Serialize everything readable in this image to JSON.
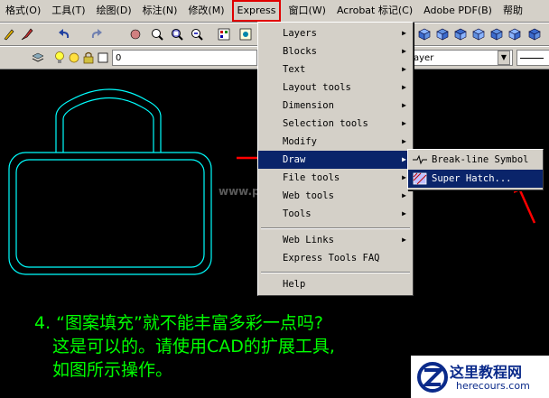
{
  "menubar": {
    "items": [
      "格式(O)",
      "工具(T)",
      "绘图(D)",
      "标注(N)",
      "修改(M)",
      "Express",
      "窗口(W)",
      "Acrobat 标记(C)",
      "Adobe PDF(B)",
      "帮助"
    ]
  },
  "toolbar2": {
    "layer_value": "0",
    "layer_right": "ayer"
  },
  "express_menu": {
    "items": [
      {
        "label": "Layers",
        "submenu": true
      },
      {
        "label": "Blocks",
        "submenu": true
      },
      {
        "label": "Text",
        "submenu": true
      },
      {
        "label": "Layout tools",
        "submenu": true
      },
      {
        "label": "Dimension",
        "submenu": true
      },
      {
        "label": "Selection tools",
        "submenu": true
      },
      {
        "label": "Modify",
        "submenu": true
      },
      {
        "label": "Draw",
        "submenu": true
      },
      {
        "label": "File tools",
        "submenu": true
      },
      {
        "label": "Web tools",
        "submenu": true
      },
      {
        "label": "Tools",
        "submenu": true
      },
      {
        "label": "Web Links",
        "submenu": true
      },
      {
        "label": "Express Tools FAQ",
        "submenu": false
      },
      {
        "label": "Help",
        "submenu": false
      }
    ]
  },
  "draw_submenu": {
    "items": [
      "Break-line Symbol",
      "Super Hatch..."
    ]
  },
  "caption": {
    "line1": "4. “图案填充”就不能丰富多彩一点吗?",
    "line2": "这是可以的。请使用CAD的扩展工具,",
    "line3": "如图所示操作。"
  },
  "watermark": "www.pl",
  "logo": {
    "text": "这里教程网",
    "url": "herecours.com"
  },
  "colors": {
    "menu_bg": "#d4d0c8",
    "highlight": "#0a246a",
    "caption": "#00ff00",
    "drawing": "#00ffff",
    "arrow": "#ff0000"
  }
}
